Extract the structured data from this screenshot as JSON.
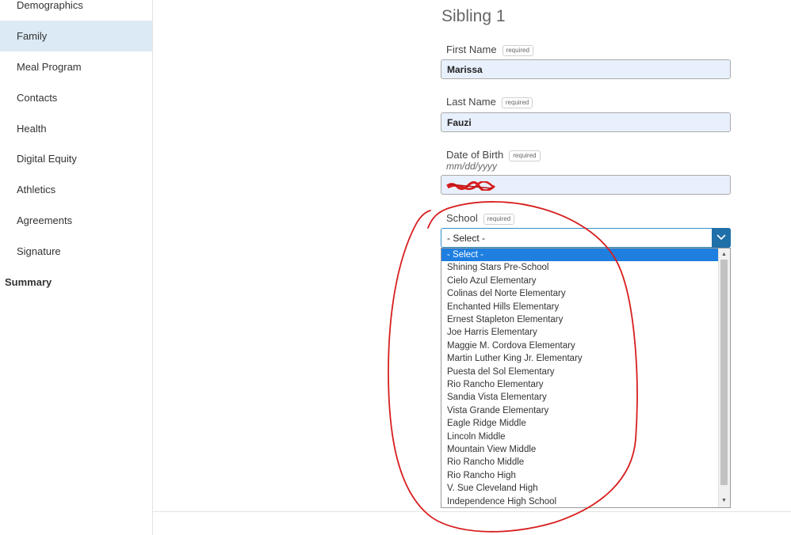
{
  "sidebar": {
    "items": [
      {
        "label": "Demographics"
      },
      {
        "label": "Family"
      },
      {
        "label": "Meal Program"
      },
      {
        "label": "Contacts"
      },
      {
        "label": "Health"
      },
      {
        "label": "Digital Equity"
      },
      {
        "label": "Athletics"
      },
      {
        "label": "Agreements"
      },
      {
        "label": "Signature"
      }
    ],
    "summary": "Summary",
    "active": "Family"
  },
  "form": {
    "title": "Sibling 1",
    "required_badge": "required",
    "first_name": {
      "label": "First Name",
      "value": "Marissa"
    },
    "last_name": {
      "label": "Last Name",
      "value": "Fauzi"
    },
    "dob": {
      "label": "Date of Birth",
      "hint": "mm/dd/yyyy"
    },
    "school": {
      "label": "School",
      "selected": "- Select -",
      "options": [
        "- Select -",
        "Shining Stars Pre-School",
        "Cielo Azul Elementary",
        "Colinas del Norte Elementary",
        "Enchanted Hills Elementary",
        "Ernest Stapleton Elementary",
        "Joe Harris Elementary",
        "Maggie M. Cordova Elementary",
        "Martin Luther King Jr. Elementary",
        "Puesta del Sol Elementary",
        "Rio Rancho Elementary",
        "Sandia Vista Elementary",
        "Vista Grande Elementary",
        "Eagle Ridge Middle",
        "Lincoln Middle",
        "Mountain View Middle",
        "Rio Rancho Middle",
        "Rio Rancho High",
        "V. Sue Cleveland High",
        "Independence High School"
      ]
    }
  },
  "colors": {
    "accent": "#1f6fa8",
    "selected_option": "#1e7fe0",
    "active_nav": "#dbeaf5",
    "annotation": "#d81e1e",
    "input_fill": "#e8f0fe"
  }
}
